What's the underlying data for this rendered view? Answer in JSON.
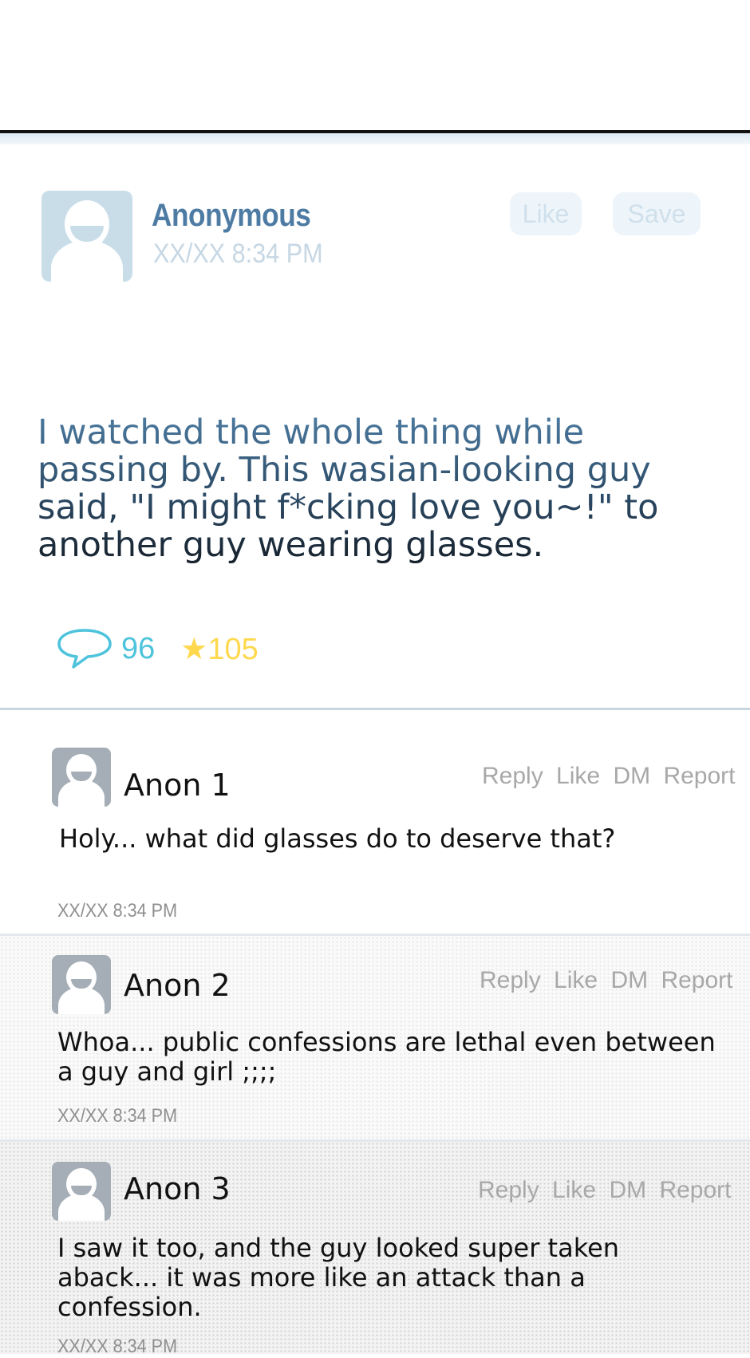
{
  "post": {
    "author": "Anonymous",
    "time": "XX/XX 8:34 PM",
    "like_label": "Like",
    "save_label": "Save",
    "body": "I watched the whole thing while passing by. This wasian-looking guy said, \"I might f*cking love you~!\" to another guy wearing glasses.",
    "comment_count": "96",
    "star_count": "★105",
    "colors": {
      "author": "#4d7ba3",
      "comment_icon": "#4ec3dc",
      "star": "#ffd84d"
    },
    "icons": {
      "comment": "speech-bubble-icon",
      "avatar": "user-silhouette-icon"
    }
  },
  "actions": {
    "reply": "Reply",
    "like": "Like",
    "dm": "DM",
    "report": "Report"
  },
  "comments": [
    {
      "name": "Anon 1",
      "text": "Holy... what did glasses do to deserve that?",
      "time": "XX/XX 8:34 PM"
    },
    {
      "name": "Anon 2",
      "text": "Whoa... public confessions are lethal even between a guy and girl ;;;;",
      "time": "XX/XX 8:34 PM"
    },
    {
      "name": "Anon 3",
      "text": "I saw it too, and the guy looked super taken aback... it was more like an attack than a confession.",
      "time": "XX/XX 8:34 PM"
    }
  ]
}
